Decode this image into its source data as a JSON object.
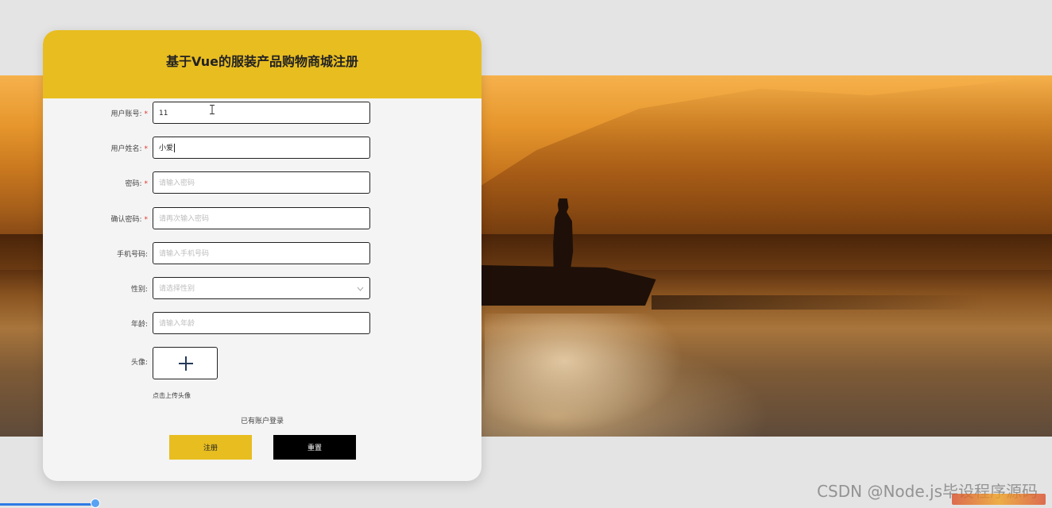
{
  "form": {
    "title": "基于Vue的服装产品购物商城注册",
    "fields": [
      {
        "label": "用户账号:",
        "required": true,
        "value": "11",
        "placeholder": ""
      },
      {
        "label": "用户姓名:",
        "required": true,
        "value": "小爱",
        "placeholder": ""
      },
      {
        "label": "密码:",
        "required": true,
        "value": "",
        "placeholder": "请输入密码"
      },
      {
        "label": "确认密码:",
        "required": true,
        "value": "",
        "placeholder": "请再次输入密码"
      },
      {
        "label": "手机号码:",
        "required": false,
        "value": "",
        "placeholder": "请输入手机号码"
      },
      {
        "label": "性别:",
        "required": false,
        "value": "",
        "placeholder": "请选择性别"
      },
      {
        "label": "年龄:",
        "required": false,
        "value": "",
        "placeholder": "请输入年龄"
      }
    ],
    "required_mark": "*",
    "avatar_label": "头像:",
    "avatar_hint": "点击上传头像",
    "login_link": "已有账户登录",
    "register_button": "注册",
    "reset_button": "重置"
  },
  "icons": {
    "select_arrow": "chevron-down-icon",
    "upload": "plus-icon",
    "cursor": "text-cursor-icon"
  },
  "watermark": "CSDN @Node.js毕设程序源码",
  "colors": {
    "accent": "#e8bd20",
    "required": "#e0312b",
    "reset_button": "#000000",
    "page_bg": "#e4e4e4"
  }
}
